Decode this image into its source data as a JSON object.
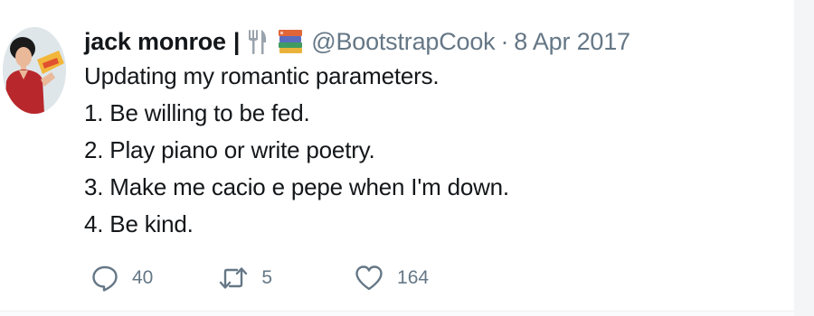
{
  "tweet": {
    "author": {
      "display_name": "jack monroe",
      "separator": "|",
      "emojis": [
        "fork-and-knife-icon",
        "books-icon"
      ],
      "handle": "@BootstrapCook",
      "date_separator": "·",
      "date": "8 Apr 2017"
    },
    "text_lines": [
      "Updating my romantic parameters.",
      "1. Be willing to be fed.",
      "2. Play piano or write poetry.",
      "3. Make me cacio e pepe when I'm down.",
      "4. Be kind."
    ],
    "actions": {
      "reply_count": "40",
      "retweet_count": "5",
      "like_count": "164"
    }
  },
  "colors": {
    "text_primary": "#14171a",
    "text_secondary": "#657786",
    "background": "#ffffff"
  }
}
